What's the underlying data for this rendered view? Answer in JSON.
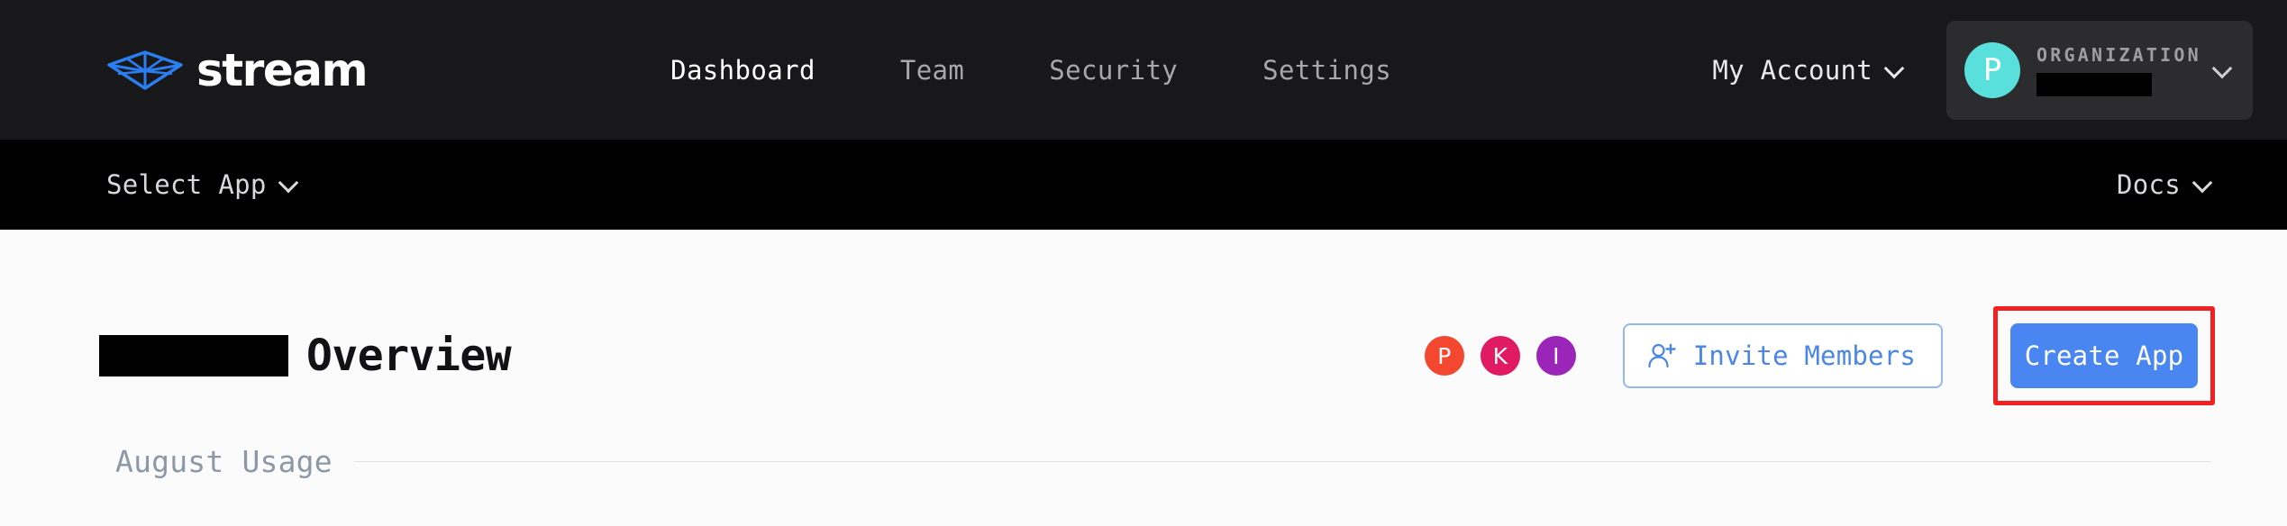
{
  "brand": {
    "logo_icon": "paper-boat-icon",
    "wordmark": "stream",
    "logo_color": "#2a7ef0"
  },
  "topnav": {
    "items": [
      {
        "label": "Dashboard",
        "active": true
      },
      {
        "label": "Team",
        "active": false
      },
      {
        "label": "Security",
        "active": false
      },
      {
        "label": "Settings",
        "active": false
      }
    ],
    "my_account": {
      "label": "My Account",
      "chevron_icon": "chevron-down-icon"
    },
    "org_switcher": {
      "avatar_initial": "P",
      "avatar_color": "#59e0dc",
      "label": "ORGANIZATION",
      "name_redacted": true,
      "chevron_icon": "chevron-down-icon"
    }
  },
  "subbar": {
    "select_app": {
      "label": "Select App",
      "chevron_icon": "chevron-down-icon"
    },
    "docs": {
      "label": "Docs",
      "chevron_icon": "chevron-down-icon"
    }
  },
  "page": {
    "title_prefix_redacted": true,
    "title": "Overview",
    "members": [
      {
        "initial": "P",
        "color": "#f4472f"
      },
      {
        "initial": "K",
        "color": "#e01b64"
      },
      {
        "initial": "I",
        "color": "#9b25b8"
      }
    ],
    "invite_button": {
      "label": "Invite Members",
      "icon": "user-plus-icon",
      "color": "#4a86e8"
    },
    "create_app_button": {
      "label": "Create App",
      "color": "#4a86f2",
      "highlighted": true,
      "highlight_color": "#f22020"
    },
    "usage_section": {
      "label": "August Usage"
    }
  }
}
